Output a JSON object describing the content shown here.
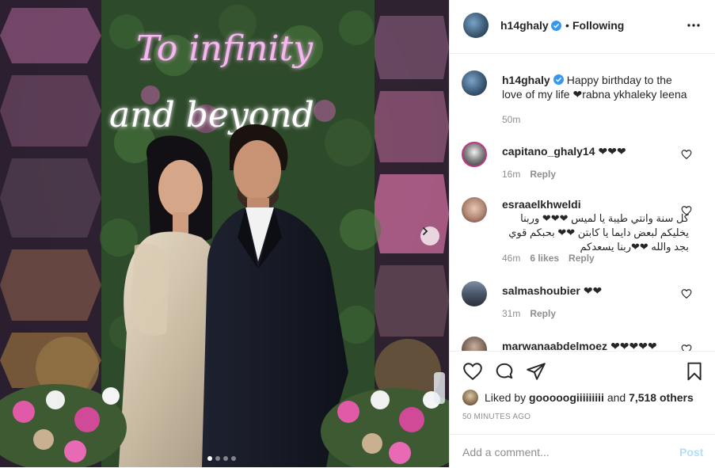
{
  "post": {
    "photo_sign_text_1": "To infinity",
    "photo_sign_text_2": "and beyond",
    "carousel_count": 4,
    "carousel_active": 1
  },
  "header": {
    "username": "h14ghaly",
    "separator": "•",
    "follow_label": "Following"
  },
  "caption": {
    "username": "h14ghaly",
    "text": "Happy birthday to the love of my life ❤rabna ykhaleky leena",
    "time": "50m"
  },
  "comments": [
    {
      "username": "capitano_ghaly14",
      "text": "❤❤❤",
      "time": "16m",
      "likes": "",
      "reply": "Reply"
    },
    {
      "username": "esraaelkhweldi",
      "text": "كل سنة وانتي طيبة يا لميس ❤❤❤ وربنا يخليكم لبعض دايما يا كابتن ❤❤ بحبكم قوي بجد والله ❤❤ربنا يسعدكم",
      "time": "46m",
      "likes": "6 likes",
      "reply": "Reply"
    },
    {
      "username": "salmashoubier",
      "text": "❤❤",
      "time": "31m",
      "likes": "",
      "reply": "Reply"
    },
    {
      "username": "marwanaabdelmoez",
      "text": "❤❤❤❤❤",
      "time": "",
      "likes": "",
      "reply": ""
    }
  ],
  "likes": {
    "prefix": "Liked by",
    "user": "gooooogiiiiiiiii",
    "conj": "and",
    "others": "7,518 others"
  },
  "timestamp": "50 MINUTES AGO",
  "composer": {
    "placeholder": "Add a comment...",
    "post_label": "Post"
  },
  "colors": {
    "verified": "#3897f0",
    "post_disabled": "#b2dffc",
    "neon_pink": "#f7b6f0",
    "muted_text": "#8e8e8e"
  }
}
